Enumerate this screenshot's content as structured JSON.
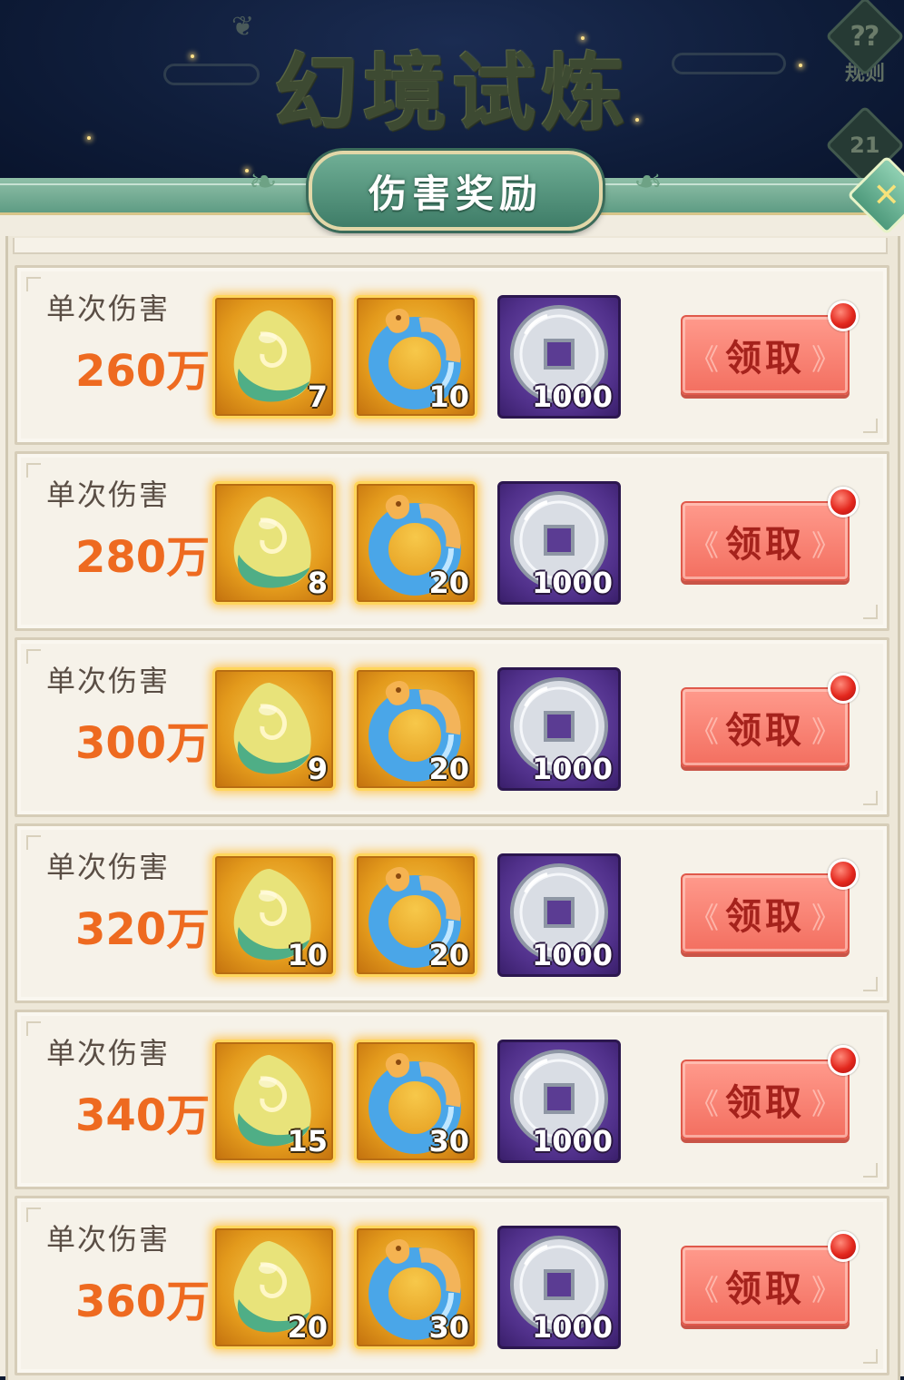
{
  "page_title": "幻境试炼",
  "panel_title": "伤害奖励",
  "side_buttons": {
    "rules_label": "规则",
    "rules_icon": "rules-scroll-icon",
    "rank_icon": "podium-rank-icon"
  },
  "close_icon": "close-icon",
  "row_label": "单次伤害",
  "claim_label": "领取",
  "colors": {
    "value_text": "#ee6a20",
    "claim_button": "#f36f60",
    "claim_text": "#a5221c",
    "panel_bg": "#f1ece0",
    "gold_frame": "#e39a1c",
    "purple_frame": "#50308a"
  },
  "reward_items": [
    {
      "name": "jade-stone",
      "icon": "jade-stone-icon",
      "rarity": "gold"
    },
    {
      "name": "jade-ring",
      "icon": "jade-ring-icon",
      "rarity": "gold"
    },
    {
      "name": "silver-coin",
      "icon": "silver-coin-icon",
      "rarity": "purple"
    }
  ],
  "tiers": [
    {
      "value": "260万",
      "counts": [
        "7",
        "10",
        "1000"
      ]
    },
    {
      "value": "280万",
      "counts": [
        "8",
        "20",
        "1000"
      ]
    },
    {
      "value": "300万",
      "counts": [
        "9",
        "20",
        "1000"
      ]
    },
    {
      "value": "320万",
      "counts": [
        "10",
        "20",
        "1000"
      ]
    },
    {
      "value": "340万",
      "counts": [
        "15",
        "30",
        "1000"
      ]
    },
    {
      "value": "360万",
      "counts": [
        "20",
        "30",
        "1000"
      ]
    }
  ]
}
